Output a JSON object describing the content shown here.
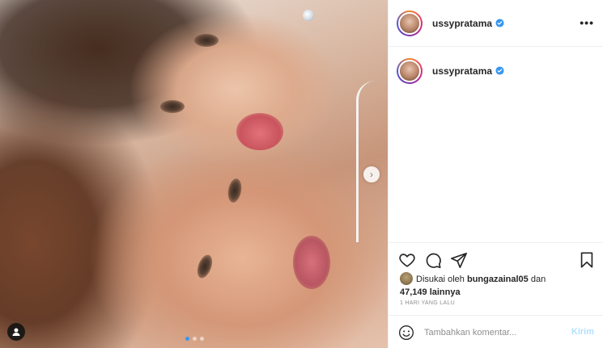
{
  "post": {
    "carousel_dots": 3,
    "active_index": 0,
    "icons": {
      "next": "chevron-right-icon",
      "tags": "user-tag-icon"
    }
  },
  "header": {
    "username": "ussypratama",
    "verified": true,
    "more_icon": "more-horizontal-icon"
  },
  "caption": {
    "username": "ussypratama",
    "verified": true
  },
  "actions": {
    "icons": [
      "heart-icon",
      "comment-icon",
      "share-icon",
      "bookmark-icon"
    ]
  },
  "likes": {
    "prefix": "Disukai oleh",
    "user": "bungazainal05",
    "connector": "dan",
    "count_text": "47,149 lainnya"
  },
  "timestamp": "1 HARI YANG LALU",
  "comment": {
    "placeholder": "Tambahkan komentar...",
    "post_label": "Kirim",
    "emoji_icon": "smiley-icon"
  },
  "colors": {
    "verified": "#3897f0",
    "post_button_disabled": "#b2dffc",
    "text_primary": "#262626",
    "text_secondary": "#8e8e8e"
  }
}
